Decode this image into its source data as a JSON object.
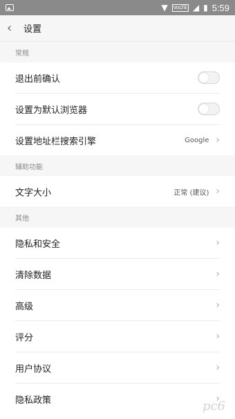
{
  "status_bar": {
    "time": "5:59",
    "network": "VoLTE"
  },
  "toolbar": {
    "title": "设置"
  },
  "sections": [
    {
      "header": "常规",
      "rows": [
        {
          "label": "退出前确认",
          "type": "toggle"
        },
        {
          "label": "设置为默认浏览器",
          "type": "toggle"
        },
        {
          "label": "设置地址栏搜索引擎",
          "value": "Google",
          "type": "nav"
        }
      ]
    },
    {
      "header": "辅助功能",
      "rows": [
        {
          "label": "文字大小",
          "value": "正常 (建议)",
          "type": "nav"
        }
      ]
    },
    {
      "header": "其他",
      "rows": [
        {
          "label": "隐私和安全",
          "type": "nav"
        },
        {
          "label": "清除数据",
          "type": "nav"
        },
        {
          "label": "高级",
          "type": "nav"
        },
        {
          "label": "评分",
          "type": "nav"
        },
        {
          "label": "用户协议",
          "type": "nav"
        },
        {
          "label": "隐私政策",
          "type": "nav"
        }
      ]
    }
  ],
  "toggles": {
    "exit_confirm_on": false,
    "default_browser_on": false
  },
  "watermark": "pc6"
}
